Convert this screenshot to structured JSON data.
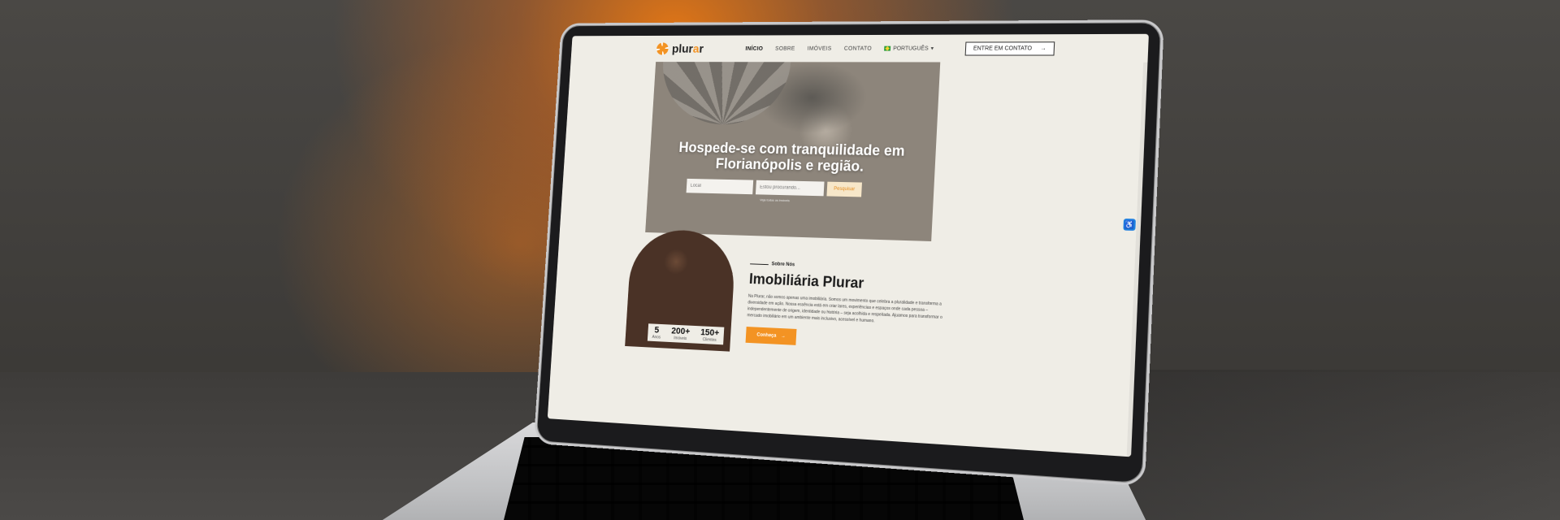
{
  "nav": {
    "logo_text": "plur",
    "logo_accent": "a",
    "logo_end": "r",
    "links": [
      "INÍCIO",
      "SOBRE",
      "IMÓVEIS",
      "CONTATO"
    ],
    "language": "PORTUGUÊS",
    "cta_label": "ENTRE EM CONTATO",
    "cta_arrow": "→"
  },
  "hero": {
    "title": "Hospede-se com tranquilidade em Florianópolis e região.",
    "location_placeholder": "Local",
    "search_placeholder": "Estou procurando...",
    "search_button": "Pesquisar",
    "hint": "Veja todos os imóveis"
  },
  "about": {
    "eyebrow": "Sobre Nós",
    "title": "Imobiliária Plurar",
    "text": "Na Plurar, não somos apenas uma imobiliária. Somos um movimento que celebra a pluralidade e transforma a diversidade em ação. Nossa essência está em criar lares, experiências e espaços onde cada pessoa – independentemente de origem, identidade ou história – seja acolhida e respeitada. Ajuamos para transformar o mercado imobiliário em um ambiente mais inclusivo, acessível e humano.",
    "button_label": "Conheça",
    "button_arrow": "→",
    "stats": [
      {
        "value": "5",
        "label": "Anos"
      },
      {
        "value": "200+",
        "label": "Imóveis"
      },
      {
        "value": "150+",
        "label": "Clientes"
      }
    ]
  },
  "colors": {
    "accent": "#f39323",
    "page_bg": "#efede6",
    "backdrop_glow": "#e87814"
  },
  "icons": {
    "accessibility": "accessibility-icon"
  }
}
